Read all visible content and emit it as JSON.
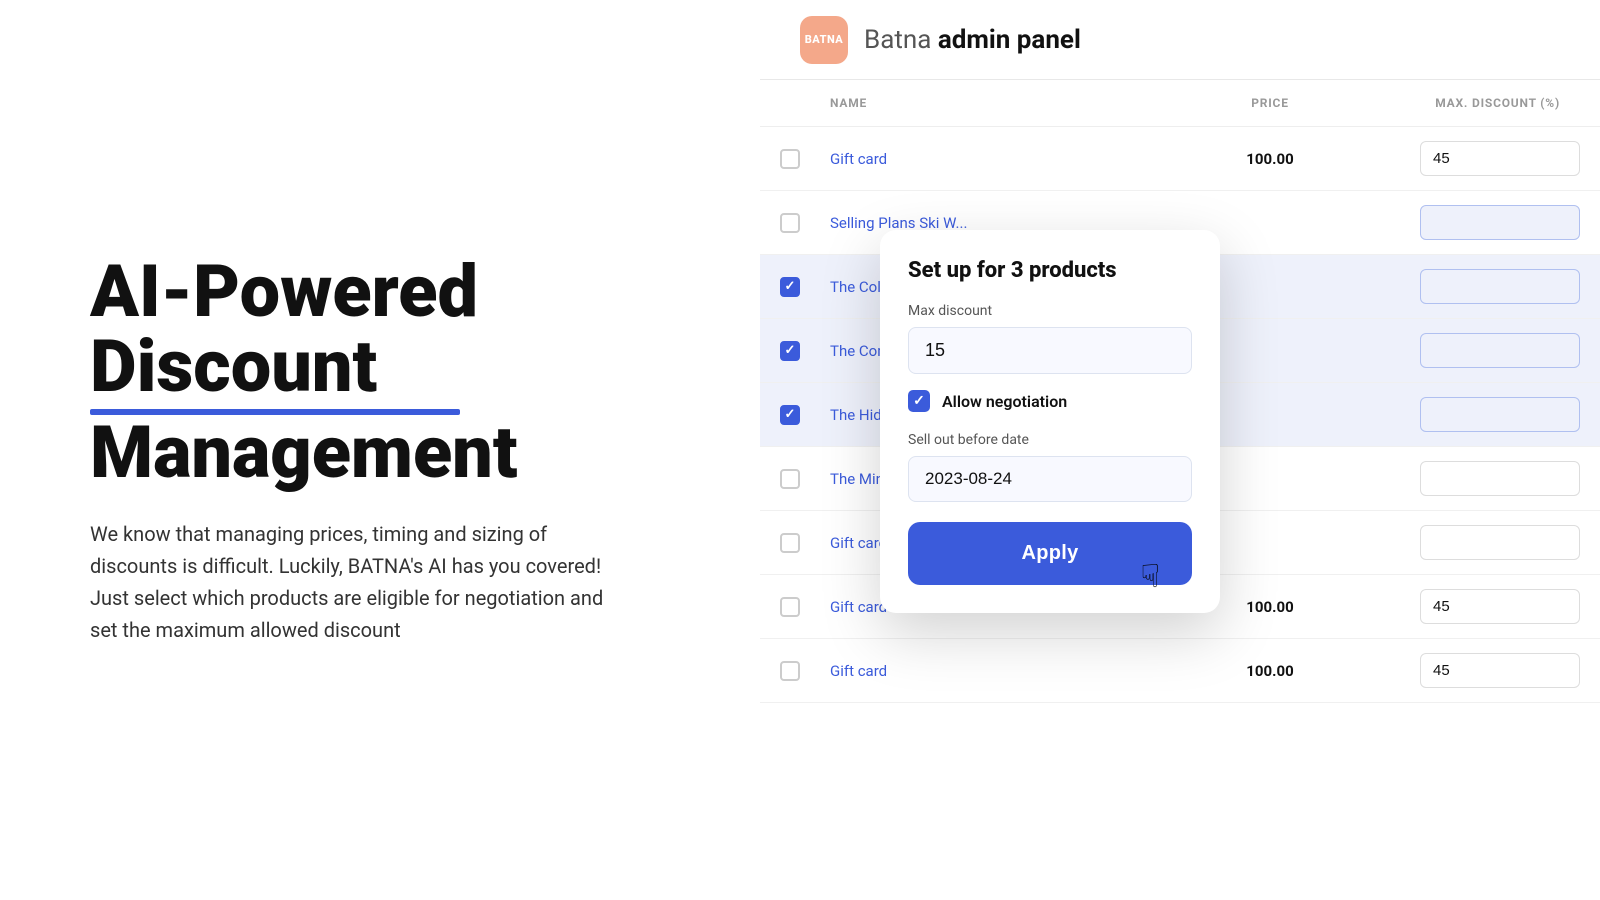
{
  "left": {
    "headline_line1": "AI-Powered",
    "headline_line2_underlined": "Discount",
    "headline_line3": "Management",
    "description": "We know that managing prices, timing and sizing of discounts is difficult. Luckily, BATNA's AI has you covered! Just select which products are eligible for negotiation and set the maximum allowed discount"
  },
  "header": {
    "logo_text": "BATNA",
    "title_plain": "Batna",
    "title_bold": "admin panel"
  },
  "table": {
    "columns": {
      "name": "NAME",
      "price": "PRICE",
      "discount": "MAX. DISCOUNT (%)"
    },
    "rows": [
      {
        "id": 1,
        "name": "Gift card",
        "price": "100.00",
        "discount": "45",
        "checked": false
      },
      {
        "id": 2,
        "name": "Selling Plans Ski W...",
        "price": "",
        "discount": "",
        "checked": false
      },
      {
        "id": 3,
        "name": "The Collection Sno... Liquid",
        "price": "",
        "discount": "",
        "checked": true
      },
      {
        "id": 4,
        "name": "The Complete Snow...",
        "price": "",
        "discount": "",
        "checked": true
      },
      {
        "id": 5,
        "name": "The Hidden Snowb...",
        "price": "",
        "discount": "",
        "checked": true
      },
      {
        "id": 6,
        "name": "The Minimal Snow...",
        "price": "",
        "discount": "",
        "checked": false
      },
      {
        "id": 7,
        "name": "Gift card",
        "price": "",
        "discount": "",
        "checked": false
      },
      {
        "id": 8,
        "name": "Gift card",
        "price": "100.00",
        "discount": "45",
        "checked": false
      },
      {
        "id": 9,
        "name": "Gift card",
        "price": "100.00",
        "discount": "45",
        "checked": false
      }
    ]
  },
  "modal": {
    "title": "Set up for 3 products",
    "max_discount_label": "Max discount",
    "max_discount_value": "15",
    "allow_negotiation_label": "Allow negotiation",
    "allow_negotiation_checked": true,
    "sell_out_label": "Sell out before date",
    "sell_out_date": "2023-08-24",
    "apply_button_label": "Apply"
  }
}
